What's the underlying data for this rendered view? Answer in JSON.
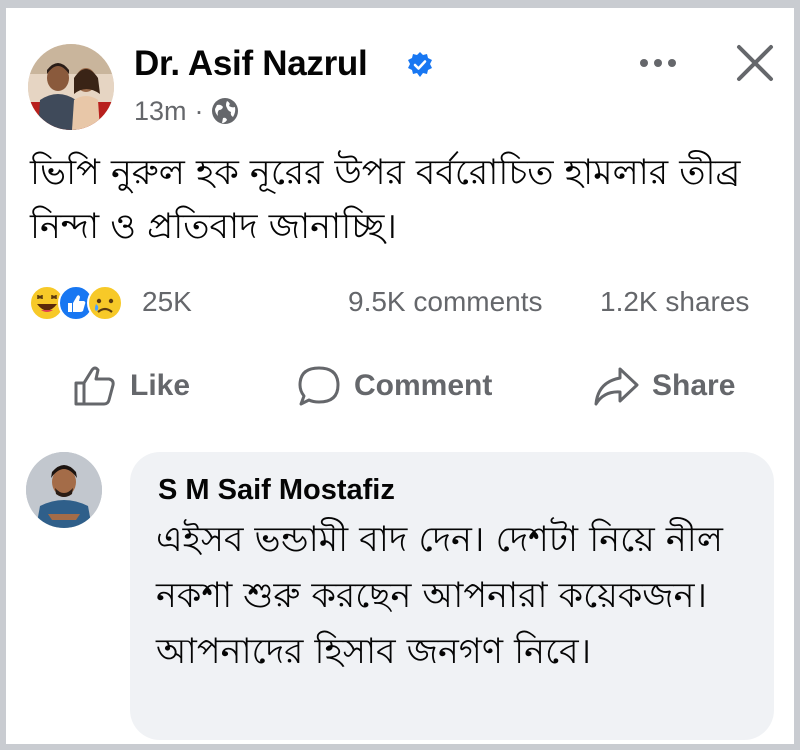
{
  "post": {
    "author_name": "Dr. Asif Nazrul",
    "timestamp": "13m",
    "separator": "·",
    "audience_icon": "globe-icon",
    "verified_icon": "verified-badge-icon",
    "text": "ভিপি নুরুল হক নূরের উপর বর্বরোচিত হামলার তীব্র নিন্দা ও প্রতিবাদ জানাচ্ছি।"
  },
  "engagement": {
    "reaction_icons": [
      "haha-reaction-icon",
      "like-reaction-icon",
      "sad-reaction-icon"
    ],
    "reactions_count": "25K",
    "comments_count": "9.5K comments",
    "shares_count": "1.2K shares"
  },
  "actions": {
    "like_label": "Like",
    "comment_label": "Comment",
    "share_label": "Share"
  },
  "comment": {
    "author_name": "S M Saif Mostafiz",
    "text": "এইসব ভন্ডামী বাদ দেন। দেশটা নিয়ে নীল নকশা শুরু করছেন আপনারা কয়েকজন। আপনাদের হিসাব জনগণ নিবে।"
  },
  "colors": {
    "verified": "#1877f2",
    "secondary_text": "#65676b",
    "comment_bubble": "#f0f2f5"
  }
}
